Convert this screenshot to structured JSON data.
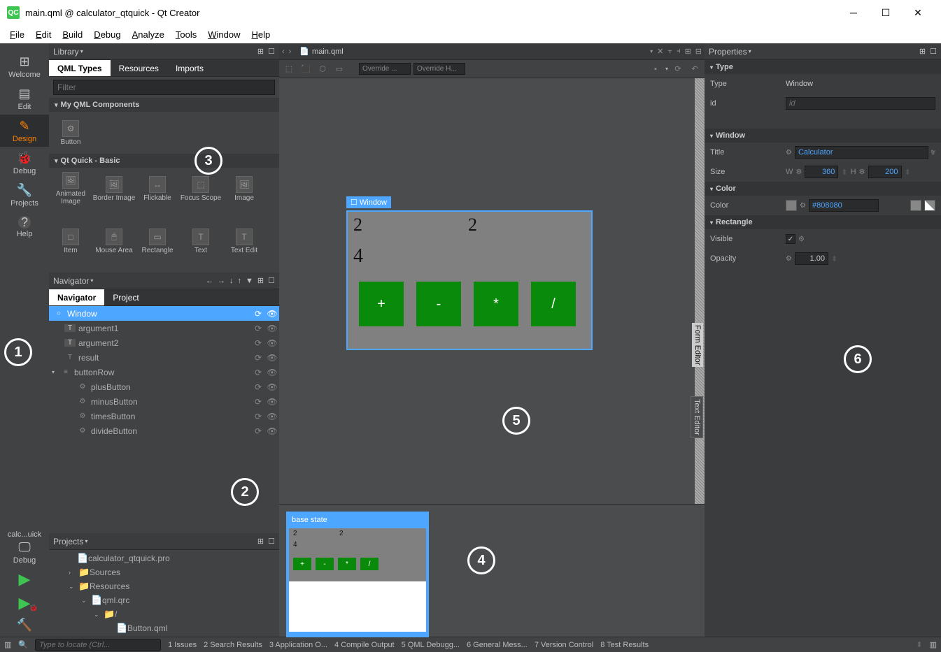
{
  "title": "main.qml @ calculator_qtquick - Qt Creator",
  "menu": [
    "File",
    "Edit",
    "Build",
    "Debug",
    "Analyze",
    "Tools",
    "Window",
    "Help"
  ],
  "sidebar": {
    "items": [
      {
        "label": "Welcome",
        "ico": "⊞"
      },
      {
        "label": "Edit",
        "ico": "▤"
      },
      {
        "label": "Design",
        "ico": "✎"
      },
      {
        "label": "Debug",
        "ico": "🐞"
      },
      {
        "label": "Projects",
        "ico": "🔧"
      },
      {
        "label": "Help",
        "ico": "?"
      }
    ],
    "context": "calc...uick",
    "debug_label": "Debug"
  },
  "library": {
    "title": "Library",
    "tabs": [
      "QML Types",
      "Resources",
      "Imports"
    ],
    "filter_ph": "Filter",
    "sec1": "My QML Components",
    "sec1_items": [
      {
        "label": "Button"
      }
    ],
    "sec2": "Qt Quick - Basic",
    "sec2_items": [
      {
        "label": "Animated Image"
      },
      {
        "label": "Border Image"
      },
      {
        "label": "Flickable"
      },
      {
        "label": "Focus Scope"
      },
      {
        "label": "Image"
      },
      {
        "label": "Item"
      },
      {
        "label": "Mouse Area"
      },
      {
        "label": "Rectangle"
      },
      {
        "label": "Text"
      },
      {
        "label": "Text Edit"
      }
    ]
  },
  "navigator": {
    "title": "Navigator",
    "tabs": [
      "Navigator",
      "Project"
    ],
    "tree": [
      {
        "label": "Window",
        "icon": "○",
        "indent": 0,
        "selected": true
      },
      {
        "label": "argument1",
        "icon": "T",
        "indent": 1
      },
      {
        "label": "argument2",
        "icon": "T",
        "indent": 1
      },
      {
        "label": "result",
        "icon": "T",
        "indent": 1
      },
      {
        "label": "buttonRow",
        "icon": "≡",
        "indent": 1,
        "exp": true
      },
      {
        "label": "plusButton",
        "icon": "⚙",
        "indent": 2
      },
      {
        "label": "minusButton",
        "icon": "⚙",
        "indent": 2
      },
      {
        "label": "timesButton",
        "icon": "⚙",
        "indent": 2
      },
      {
        "label": "divideButton",
        "icon": "⚙",
        "indent": 2
      }
    ]
  },
  "projects": {
    "title": "Projects",
    "tree": [
      {
        "label": "calculator_qtquick.pro",
        "icon": "📄",
        "indent": 0
      },
      {
        "label": "Sources",
        "icon": "📁",
        "indent": 1,
        "arrow": "›"
      },
      {
        "label": "Resources",
        "icon": "📁",
        "indent": 1,
        "arrow": "⌄"
      },
      {
        "label": "qml.qrc",
        "icon": "📄",
        "indent": 2,
        "arrow": "⌄"
      },
      {
        "label": "/",
        "icon": "📁",
        "indent": 3,
        "arrow": "⌄"
      },
      {
        "label": "Button.qml",
        "icon": "📄",
        "indent": 4
      }
    ]
  },
  "center": {
    "file": "main.qml",
    "override1": "Override ...",
    "override2": "Override H...",
    "win_label": "Window",
    "arg1": "2",
    "arg2": "2",
    "res": "4",
    "ops": [
      "+",
      "-",
      "*",
      "/"
    ],
    "base_state": "base state",
    "form_editor": "Form Editor",
    "text_editor": "Text Editor"
  },
  "props": {
    "title": "Properties",
    "sec_type": "Type",
    "type_label": "Type",
    "type_val": "Window",
    "id_label": "id",
    "id_ph": "id",
    "sec_window": "Window",
    "title_label": "Title",
    "title_val": "Calculator",
    "tr": "tr",
    "size_label": "Size",
    "w": "W",
    "w_val": "360",
    "h": "H",
    "h_val": "200",
    "sec_color": "Color",
    "color_label": "Color",
    "color_val": "#808080",
    "sec_rect": "Rectangle",
    "vis_label": "Visible",
    "vis_check": "✓",
    "opa_label": "Opacity",
    "opa_val": "1.00"
  },
  "status": {
    "search_ph": "Type to locate (Ctrl...",
    "items": [
      "1  Issues",
      "2  Search Results",
      "3  Application O...",
      "4  Compile Output",
      "5  QML Debugg...",
      "6  General Mess...",
      "7  Version Control",
      "8  Test Results"
    ]
  },
  "annotations": [
    "1",
    "2",
    "3",
    "4",
    "5",
    "6"
  ]
}
